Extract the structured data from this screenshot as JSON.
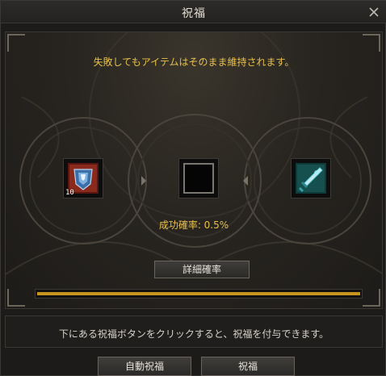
{
  "window": {
    "title": "祝福"
  },
  "notice": "失敗してもアイテムはそのまま維持されます。",
  "slots": {
    "left": {
      "icon": "shield-armor-icon",
      "count": "10"
    },
    "center": {
      "icon": "empty-slot-icon"
    },
    "right": {
      "icon": "sword-weapon-icon"
    }
  },
  "rate": "成功確率: 0.5%",
  "detail_button": "詳細確率",
  "progress": {
    "fraction": 1.0,
    "color": "#c7951e"
  },
  "info": "下にある祝福ボタンをクリックすると、祝福を付与できます。",
  "buttons": {
    "auto": "自動祝福",
    "bless": "祝福"
  },
  "colors": {
    "accent": "#e8c04a"
  }
}
